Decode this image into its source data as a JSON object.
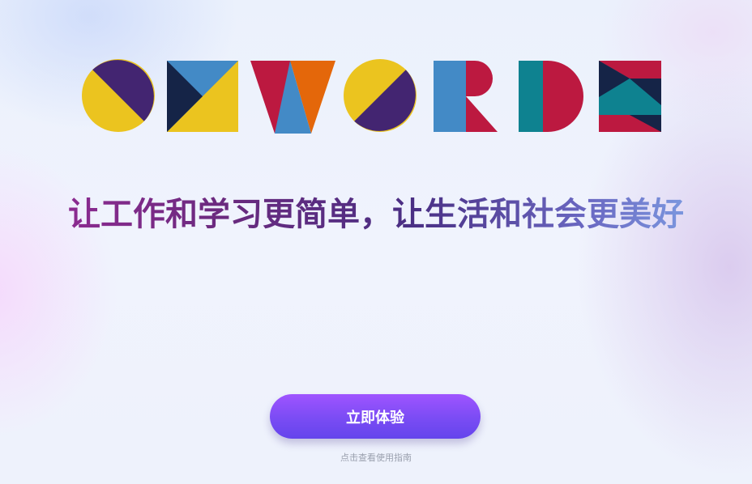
{
  "brand": {
    "logo_text": "OKWORDS",
    "colors": {
      "yellow": "#ebc41f",
      "purple": "#432571",
      "navy": "#152447",
      "blue": "#438ac6",
      "red": "#bc1940",
      "orange": "#e4670a",
      "teal": "#0e8290"
    }
  },
  "hero": {
    "slogan": "让工作和学习更简单，让生活和社会更美好"
  },
  "cta": {
    "button_label": "立即体验",
    "guide_link": "点击查看使用指南",
    "accent": "#7a4cf4"
  }
}
